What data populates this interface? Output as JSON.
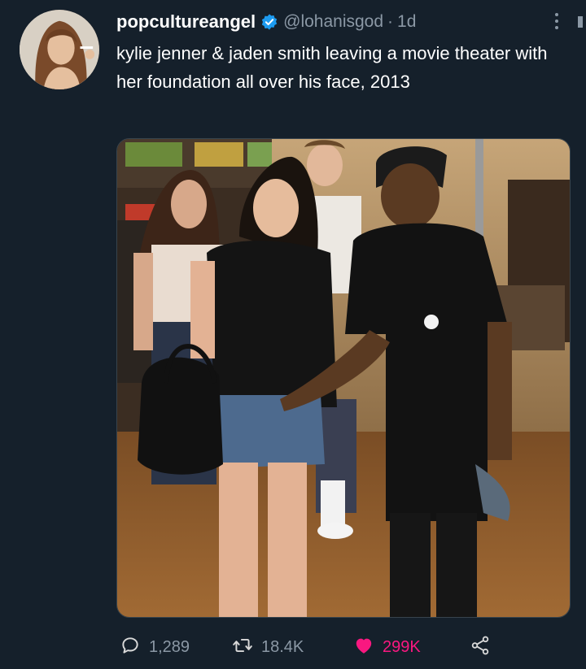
{
  "tweet": {
    "display_name": "popcultureangel",
    "handle": "@lohanisgod",
    "separator": "·",
    "time": "1d",
    "text": "kylie jenner & jaden smith leaving a movie theater with her foundation all over his face, 2013",
    "verified": true,
    "icons": {
      "verified": "verified-badge-icon",
      "more": "more-vertical-icon",
      "reply": "reply-icon",
      "retweet": "retweet-icon",
      "like": "heart-icon",
      "share": "share-icon"
    },
    "colors": {
      "background": "#15202b",
      "text": "#ffffff",
      "muted": "#8b98a5",
      "verified": "#1d9bf0",
      "like": "#f91880"
    }
  },
  "stats": {
    "replies": "1,289",
    "retweets": "18.4K",
    "likes": "299K",
    "liked": true
  }
}
